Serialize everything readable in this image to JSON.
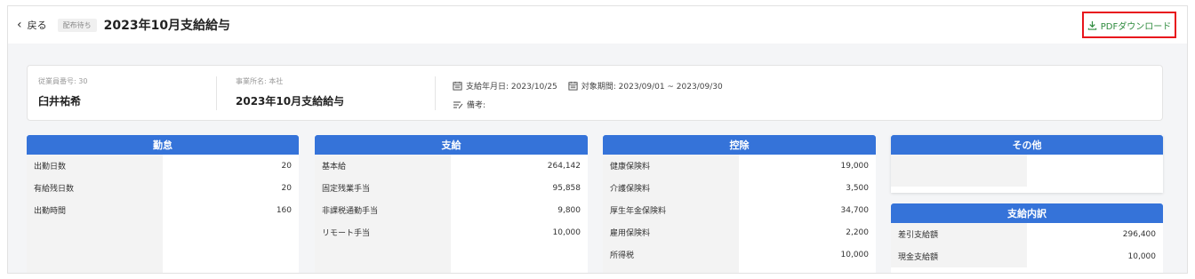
{
  "header": {
    "back_label": "戻る",
    "status_badge": "配布待ち",
    "title": "2023年10月支給給与",
    "pdf_label": "PDFダウンロード"
  },
  "info": {
    "employee_no": "従業員番号: 30",
    "employee_name": "臼井祐希",
    "office": "事業所名: 本社",
    "payroll_name": "2023年10月支給給与",
    "pay_date": "支給年月日: 2023/10/25",
    "period": "対象期間: 2023/09/01 ~ 2023/09/30",
    "note": "備考:"
  },
  "panels": {
    "attendance": {
      "title": "勤怠",
      "rows": [
        {
          "label": "出勤日数",
          "value": "20"
        },
        {
          "label": "有給残日数",
          "value": "20"
        },
        {
          "label": "出勤時間",
          "value": "160"
        }
      ]
    },
    "payment": {
      "title": "支給",
      "rows": [
        {
          "label": "基本給",
          "value": "264,142"
        },
        {
          "label": "固定残業手当",
          "value": "95,858"
        },
        {
          "label": "非課税通勤手当",
          "value": "9,800"
        },
        {
          "label": "リモート手当",
          "value": "10,000"
        }
      ]
    },
    "deduction": {
      "title": "控除",
      "rows": [
        {
          "label": "健康保険料",
          "value": "19,000"
        },
        {
          "label": "介護保険料",
          "value": "3,500"
        },
        {
          "label": "厚生年金保険料",
          "value": "34,700"
        },
        {
          "label": "雇用保険料",
          "value": "2,200"
        },
        {
          "label": "所得税",
          "value": "10,000"
        }
      ]
    },
    "other": {
      "title": "その他"
    },
    "breakdown": {
      "title": "支給内訳",
      "rows": [
        {
          "label": "差引支給額",
          "value": "296,400"
        },
        {
          "label": "現金支給額",
          "value": "10,000"
        }
      ]
    }
  },
  "colors": {
    "panel_header": "#3573d9",
    "pdf_text": "#2e8b3e",
    "highlight_border": "#e8141c"
  }
}
